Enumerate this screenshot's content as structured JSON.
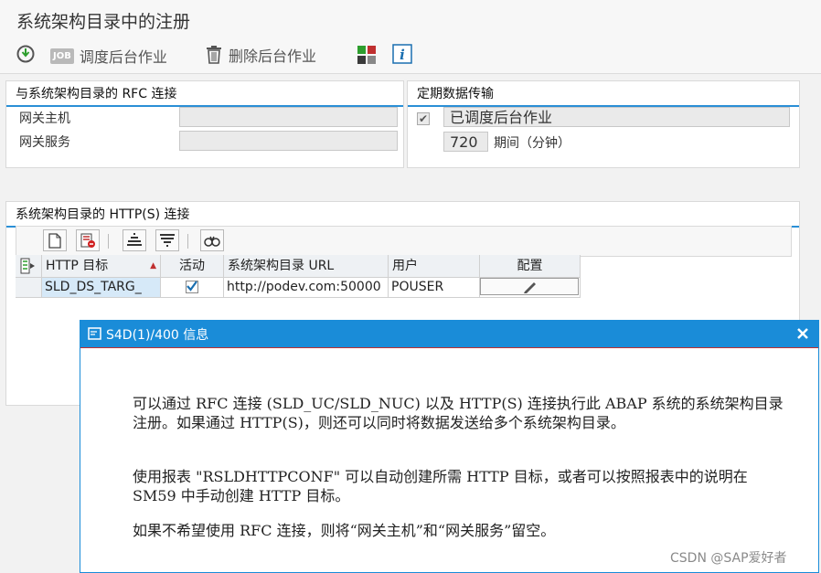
{
  "window": {
    "title": "系统架构目录中的注册"
  },
  "toolbar": {
    "job_badge": "JOB",
    "schedule_label": "调度后台作业",
    "delete_label": "删除后台作业"
  },
  "rfc_group": {
    "title": "与系统架构目录的 RFC 连接",
    "gateway_host_label": "网关主机",
    "gateway_host_value": "",
    "gateway_service_label": "网关服务",
    "gateway_service_value": ""
  },
  "transfer_group": {
    "title": "定期数据传输",
    "scheduled_checked": true,
    "scheduled_label": "已调度后台作业",
    "period_value": "720",
    "period_label": "期间（分钟）"
  },
  "http_group": {
    "title": "系统架构目录的 HTTP(S) 连接",
    "columns": [
      "HTTP 目标",
      "活动",
      "系统架构目录 URL",
      "用户",
      "配置"
    ],
    "rows": [
      {
        "target": "SLD_DS_TARG_",
        "active": true,
        "url": "http://podev.com:50000",
        "user": "POUSER"
      }
    ]
  },
  "dialog": {
    "title": "S4D(1)/400 信息",
    "para1": "可以通过 RFC 连接 (SLD_UC/SLD_NUC) 以及 HTTP(S) 连接执行此 ABAP 系统的系统架构目录注册。如果通过 HTTP(S)，则还可以同时将数据发送给多个系统架构目录。",
    "para2": "使用报表 \"RSLDHTTPCONF\" 可以自动创建所需 HTTP 目标，或者可以按照报表中的说明在 SM59 中手动创建 HTTP 目标。",
    "para3": "如果不希望使用 RFC 连接，则将“网关主机”和“网关服务”留空。"
  },
  "watermark": "CSDN @SAP爱好者",
  "colors": {
    "accent": "#1a8cd8",
    "header_bg": "#eef1f4",
    "field_bg": "#eaeaea"
  }
}
